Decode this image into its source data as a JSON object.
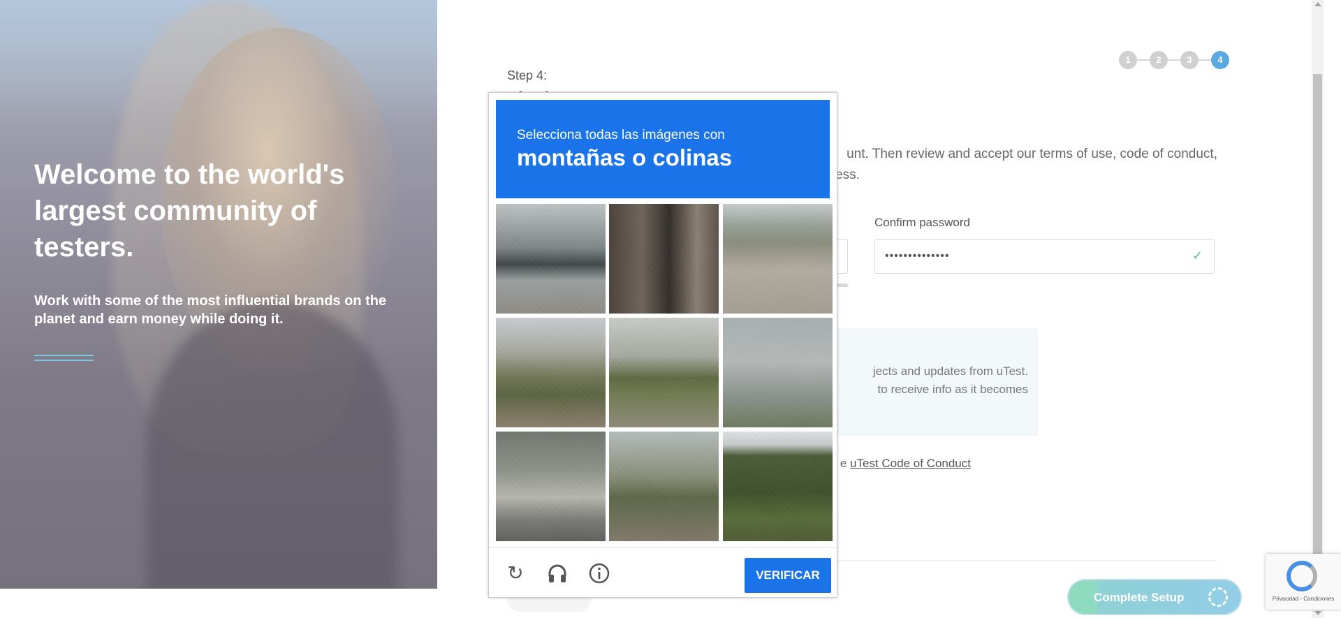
{
  "hero": {
    "headline": "Welcome to the world's largest community of testers.",
    "subtext": "Work with some of the most influential brands on the planet and earn money while doing it."
  },
  "stepper": {
    "steps": [
      "1",
      "2",
      "3",
      "4"
    ],
    "active_step": 4
  },
  "form": {
    "step_label": "Step 4:",
    "step_title": "The last step",
    "description": "unt. Then review and accept our terms of use, code of conduct,",
    "description_line2": "ocess.",
    "confirm_password_label": "Confirm password",
    "confirm_password_value": "••••••••••••••",
    "info_line1": "jects and updates from uTest.",
    "info_line2": "to receive info as it becomes",
    "coc_prefix": "e ",
    "coc_link": "uTest Code of Conduct",
    "complete_button": "Complete Setup"
  },
  "captcha": {
    "instruction": "Selecciona todas las imágenes con",
    "object": "montañas o colinas",
    "verify_label": "VERIFICAR",
    "tiles": [
      {
        "desc": "building-facade"
      },
      {
        "desc": "storefront-street"
      },
      {
        "desc": "crosswalk-road"
      },
      {
        "desc": "palm-trees-mountain"
      },
      {
        "desc": "roadside-field"
      },
      {
        "desc": "traffic-light"
      },
      {
        "desc": "parked-car"
      },
      {
        "desc": "street-lamp-tree"
      },
      {
        "desc": "forest-hills"
      }
    ]
  },
  "recaptcha_badge": {
    "text": "Privacidad - Condiciones"
  },
  "colors": {
    "captcha_blue": "#1a73e8",
    "step_active": "#5aa9e0",
    "complete_button": "#93cde8"
  }
}
